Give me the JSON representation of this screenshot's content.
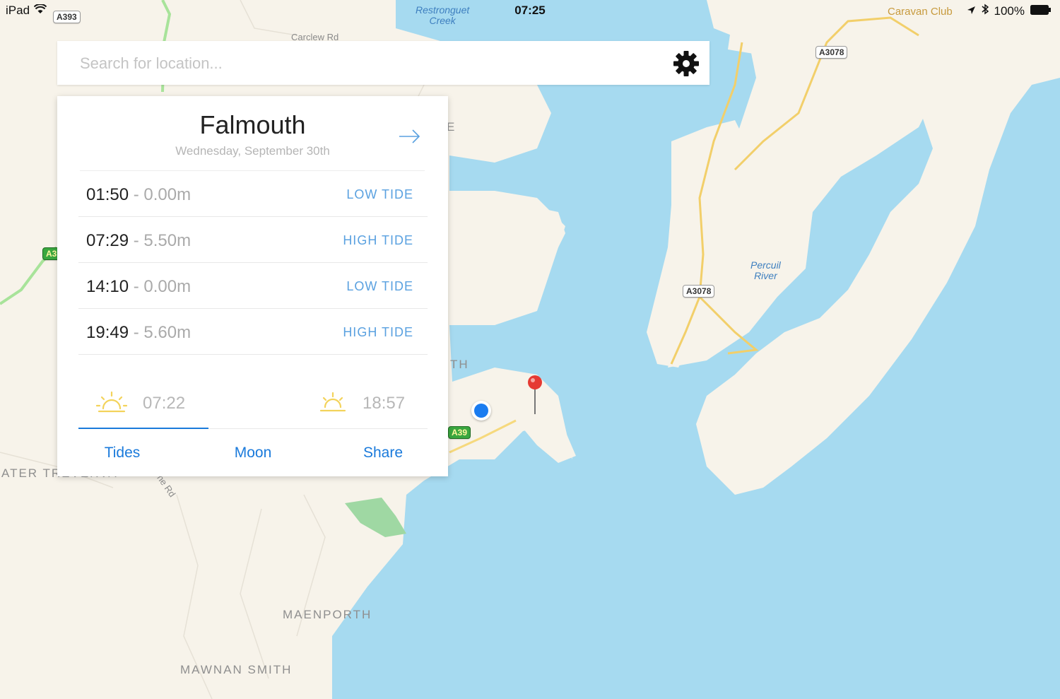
{
  "status_bar": {
    "device": "iPad",
    "time": "07:25",
    "battery": "100%",
    "icons": [
      "wifi-icon",
      "location-arrow-icon",
      "bluetooth-icon",
      "battery-icon"
    ]
  },
  "search": {
    "placeholder": "Search for location...",
    "settings_icon": "gear-icon"
  },
  "tide_card": {
    "location": "Falmouth",
    "date": "Wednesday, September 30th",
    "next_icon": "arrow-right-icon",
    "tides": [
      {
        "time": "01:50",
        "separator": " - ",
        "height": "0.00m",
        "type": "LOW TIDE"
      },
      {
        "time": "07:29",
        "separator": " - ",
        "height": "5.50m",
        "type": "HIGH TIDE"
      },
      {
        "time": "14:10",
        "separator": " - ",
        "height": "0.00m",
        "type": "LOW TIDE"
      },
      {
        "time": "19:49",
        "separator": " - ",
        "height": "5.60m",
        "type": "HIGH TIDE"
      }
    ],
    "sunrise": {
      "icon": "sunrise-icon",
      "time": "07:22"
    },
    "sunset": {
      "icon": "sunset-icon",
      "time": "18:57"
    },
    "tabs": [
      {
        "label": "Tides",
        "active": true
      },
      {
        "label": "Moon",
        "active": false
      },
      {
        "label": "Share",
        "active": false
      }
    ]
  },
  "map": {
    "water_labels": {
      "restronguet": "Restronguet\nCreek",
      "percuil": "Percuil\nRiver"
    },
    "place_labels": {
      "maenporth": "MAENPORTH",
      "mawnan_smith": "MAWNAN SMITH",
      "treverva": "ATER TREVERVA",
      "falmouth_partial": "TH",
      "partial_e": "E"
    },
    "road_labels": {
      "carclew": "Carclew Rd",
      "rd": "ne Rd"
    },
    "poi_labels": {
      "caravan_club": "Caravan Club"
    },
    "road_shields": {
      "a393": "A393",
      "a3078_top": "A3078",
      "a3078_mid": "A3078",
      "a39": "A39",
      "a3_partial": "A3"
    },
    "colors": {
      "water": "#a6daf0",
      "land": "#f7f3ea",
      "accent_blue": "#1a7adb",
      "tide_type_blue": "#5aa1e0",
      "sun_yellow": "#f3d35b",
      "pin_red": "#e53a33",
      "user_location": "#1a7cf0"
    }
  }
}
